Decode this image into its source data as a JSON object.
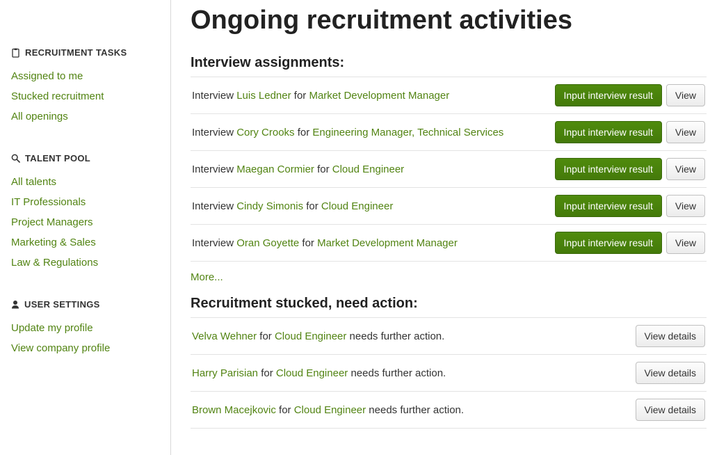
{
  "page": {
    "title": "Ongoing recruitment activities"
  },
  "sidebar": {
    "section1": {
      "heading": "RECRUITMENT TASKS",
      "items": [
        "Assigned to me",
        "Stucked recruitment",
        "All openings"
      ]
    },
    "section2": {
      "heading": "TALENT POOL",
      "items": [
        "All talents",
        "IT Professionals",
        "Project Managers",
        "Marketing & Sales",
        "Law & Regulations"
      ]
    },
    "section3": {
      "heading": "USER SETTINGS",
      "items": [
        "Update my profile",
        "View company profile"
      ]
    }
  },
  "interviews": {
    "heading": "Interview assignments:",
    "prefix": "Interview ",
    "for": " for ",
    "rows": [
      {
        "candidate": "Luis Ledner",
        "position": "Market Development Manager"
      },
      {
        "candidate": "Cory Crooks",
        "position": "Engineering Manager, Technical Services"
      },
      {
        "candidate": "Maegan Cormier",
        "position": "Cloud Engineer"
      },
      {
        "candidate": "Cindy Simonis",
        "position": "Cloud Engineer"
      },
      {
        "candidate": "Oran Goyette",
        "position": "Market Development Manager"
      }
    ],
    "action_primary": "Input interview result",
    "action_secondary": "View",
    "more": "More..."
  },
  "stucked": {
    "heading": "Recruitment stucked, need action:",
    "for": " for ",
    "suffix": " needs further action.",
    "rows": [
      {
        "candidate": "Velva Wehner",
        "position": "Cloud Engineer"
      },
      {
        "candidate": "Harry Parisian",
        "position": "Cloud Engineer"
      },
      {
        "candidate": "Brown Macejkovic",
        "position": "Cloud Engineer"
      }
    ],
    "action": "View details"
  }
}
